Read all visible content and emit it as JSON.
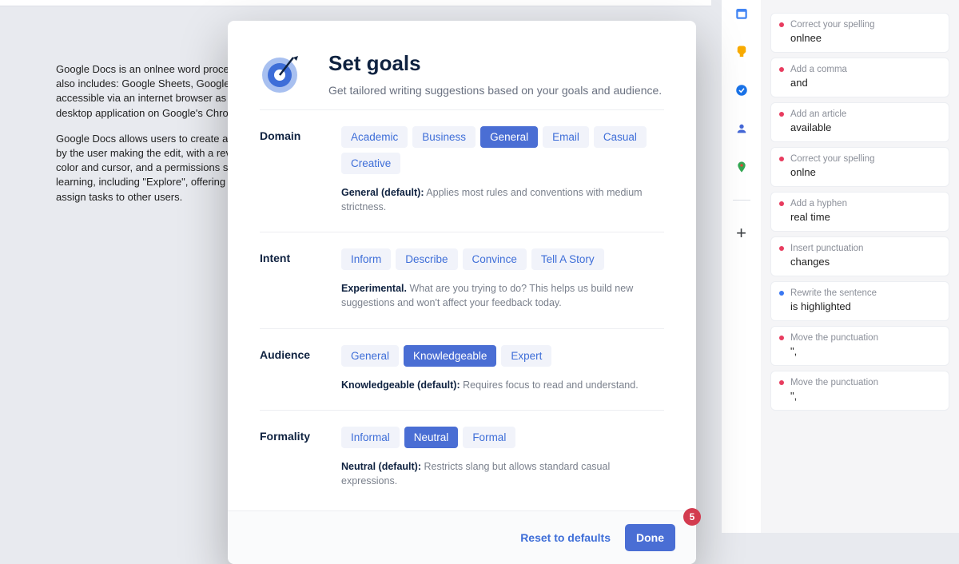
{
  "document": {
    "para1": "Google Docs is an onlnee word processor included as part of a free, web-based software office suite offered by Google, which also includes: Google Sheets, Google Slides, Google Drawings, Google Forms, Google Sites, and Google Keep. Google Docs is accessible via an internet browser as a web-based application and is also available as a mobile app on Android and iOS and as a desktop application on Google's Chrome OS.",
    "para2": "Google Docs allows users to create and edit documents online while collaborating with other users in real time. Edits are tracked by the user making the edit, with a revision history presenting changes. An editor's position is highlighted with an editor-specific color and cursor, and a permissions system regulates what users can do. Updates have introduced features using machine learning, including \"Explore\", offering search results based on the contents of a document, and \"Action items\", allowing users to assign tasks to other users."
  },
  "modal": {
    "title": "Set goals",
    "subtitle": "Get tailored writing suggestions based on your goals and audience.",
    "sections": {
      "domain": {
        "label": "Domain",
        "options": [
          "Academic",
          "Business",
          "General",
          "Email",
          "Casual",
          "Creative"
        ],
        "selected": "General",
        "desc_bold": "General (default):",
        "desc_rest": " Applies most rules and conventions with medium strictness."
      },
      "intent": {
        "label": "Intent",
        "options": [
          "Inform",
          "Describe",
          "Convince",
          "Tell A Story"
        ],
        "selected": null,
        "desc_bold": "Experimental.",
        "desc_rest": " What are you trying to do? This helps us build new suggestions and won't affect your feedback today."
      },
      "audience": {
        "label": "Audience",
        "options": [
          "General",
          "Knowledgeable",
          "Expert"
        ],
        "selected": "Knowledgeable",
        "desc_bold": "Knowledgeable (default):",
        "desc_rest": " Requires focus to read and understand."
      },
      "formality": {
        "label": "Formality",
        "options": [
          "Informal",
          "Neutral",
          "Formal"
        ],
        "selected": "Neutral",
        "desc_bold": "Neutral (default):",
        "desc_rest": " Restricts slang but allows standard casual expressions."
      }
    },
    "reset_label": "Reset to defaults",
    "done_label": "Done"
  },
  "rail": {
    "icons": [
      "calendar-icon",
      "keep-icon",
      "tasks-icon",
      "contacts-icon",
      "maps-icon"
    ],
    "colors": [
      "#4285f4",
      "#f9ab00",
      "#1a73e8",
      "#4467d6",
      "#34a853"
    ]
  },
  "suggestions": [
    {
      "label": "Correct your spelling",
      "value": "onlnee",
      "color": "red"
    },
    {
      "label": "Add a comma",
      "value": "and",
      "color": "red"
    },
    {
      "label": "Add an article",
      "value": "available",
      "color": "red"
    },
    {
      "label": "Correct your spelling",
      "value": "onlne",
      "color": "red"
    },
    {
      "label": "Add a hyphen",
      "value": "real time",
      "color": "red"
    },
    {
      "label": "Insert punctuation",
      "value": "changes",
      "color": "red"
    },
    {
      "label": "Rewrite the sentence",
      "value": "is highlighted",
      "color": "blue"
    },
    {
      "label": "Move the punctuation",
      "value": "\",",
      "color": "red"
    },
    {
      "label": "Move the punctuation",
      "value": "\",",
      "color": "red"
    }
  ],
  "counter": "5"
}
